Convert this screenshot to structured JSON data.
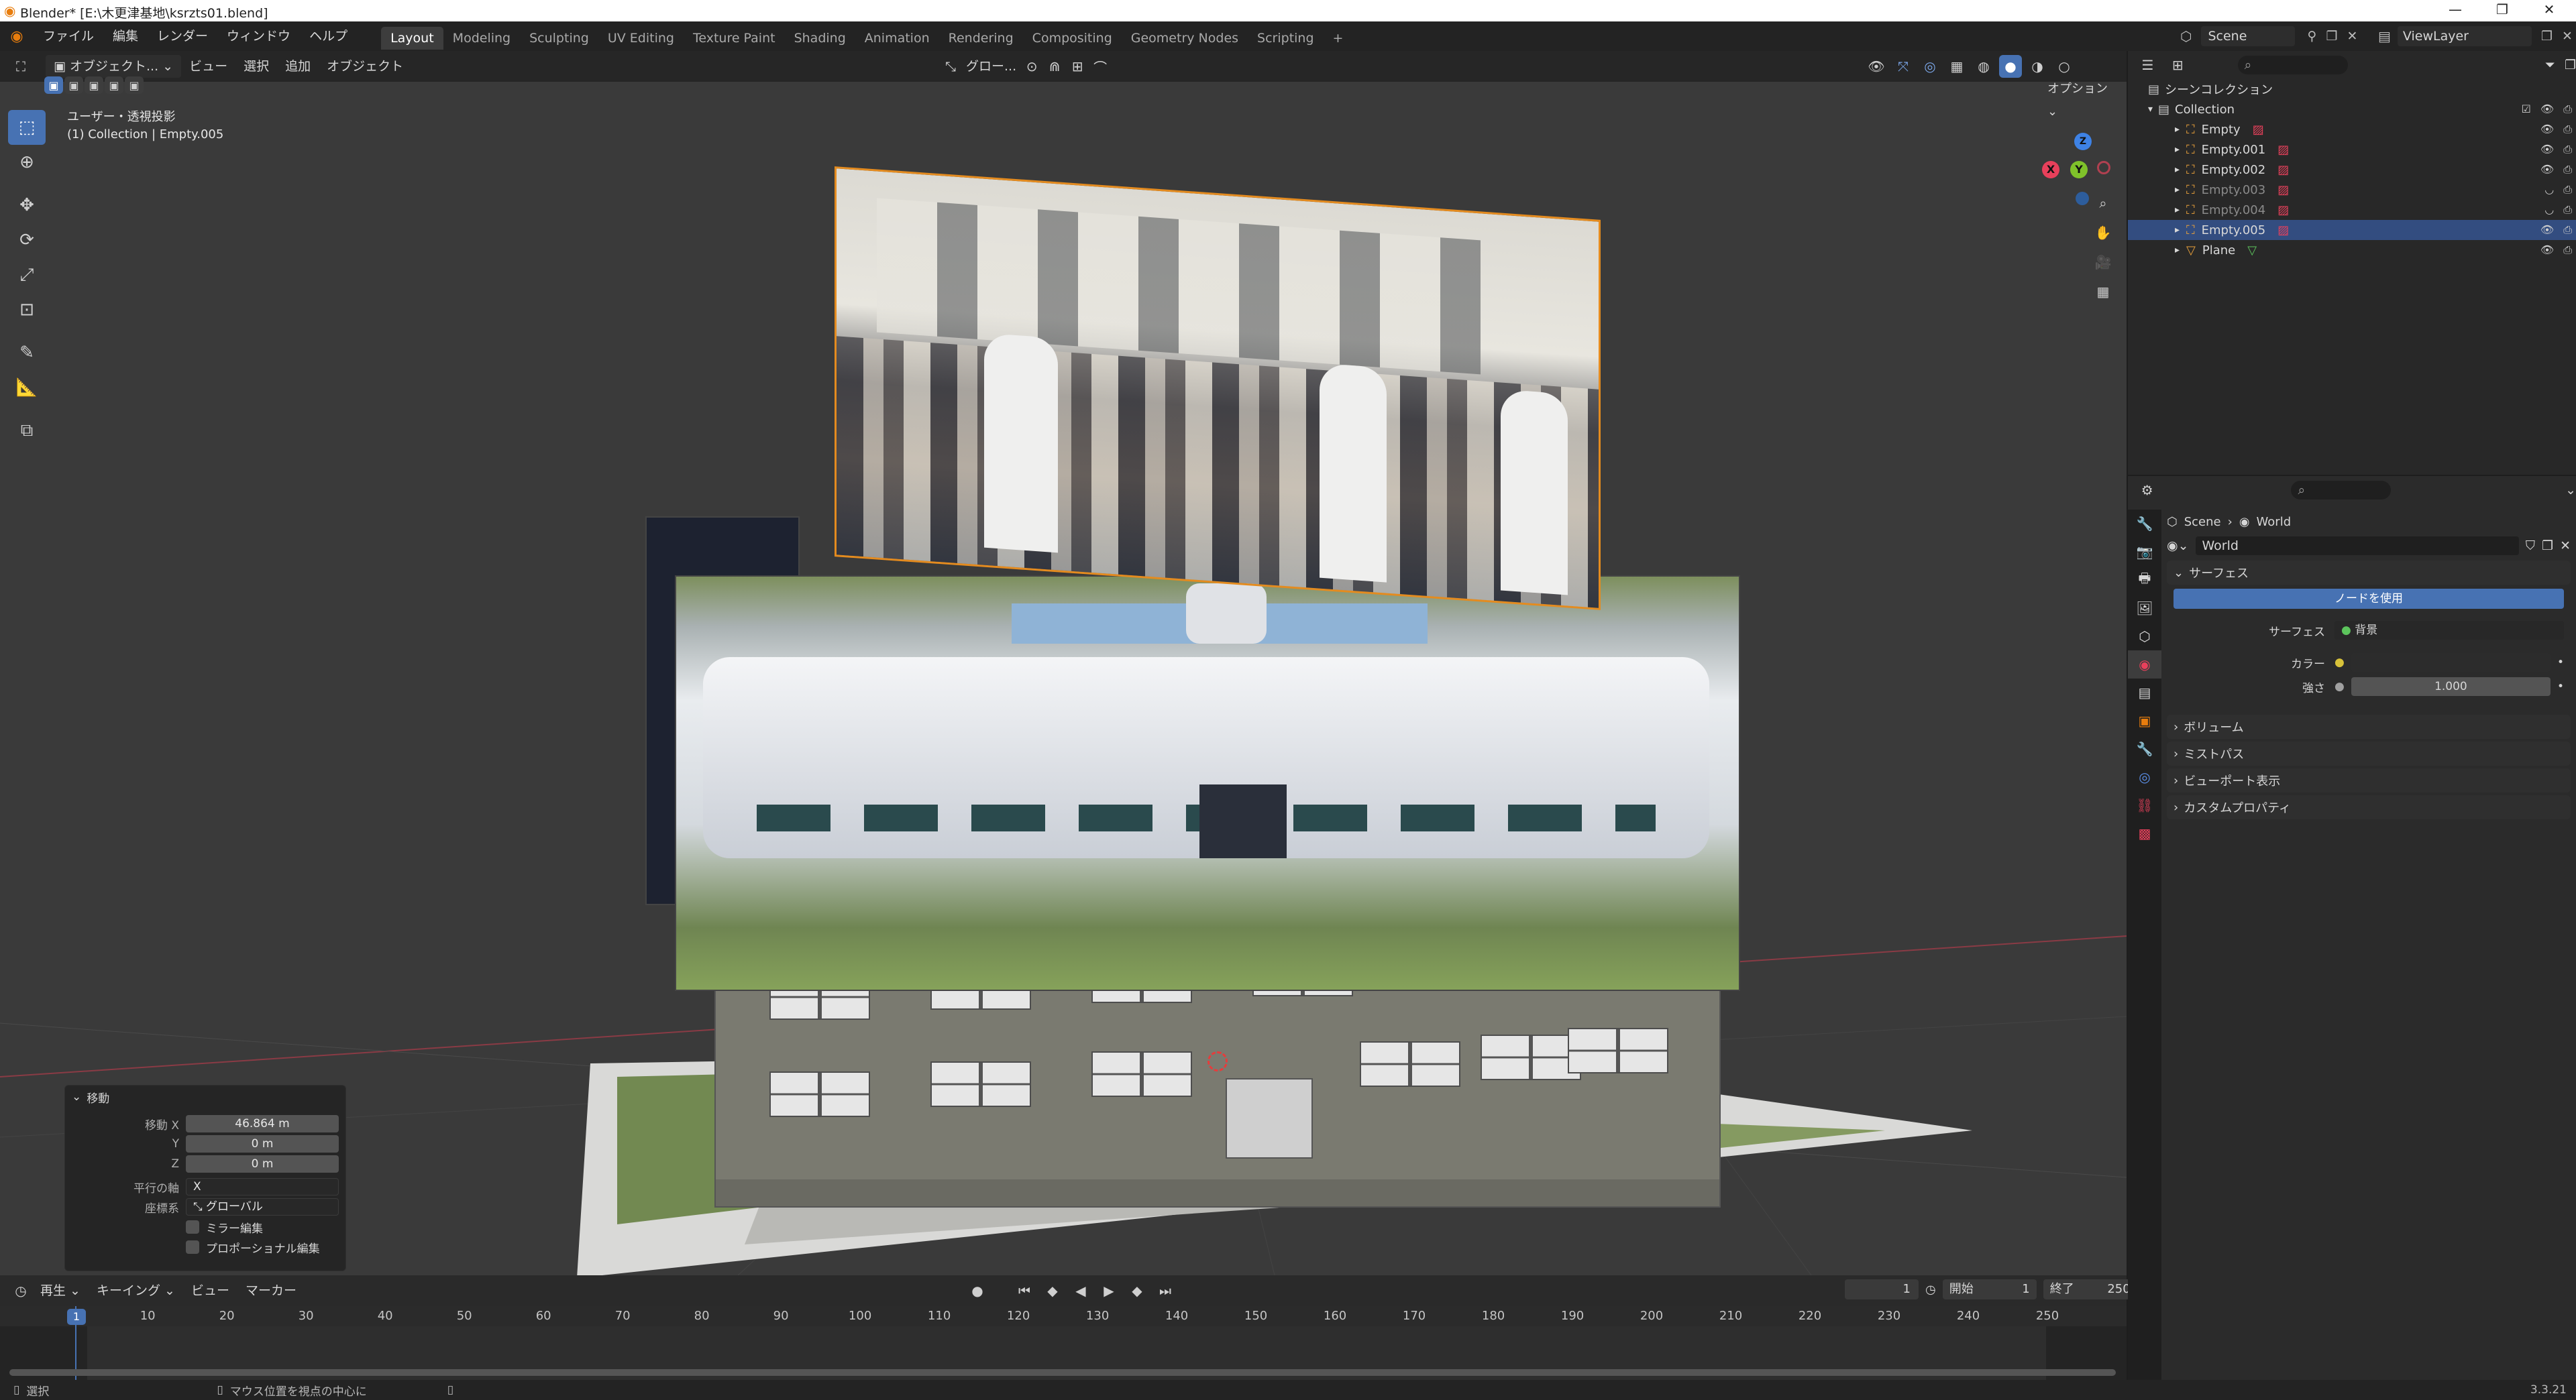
{
  "window": {
    "title": "Blender* [E:\\木更津基地\\ksrzts01.blend]",
    "controls": [
      "—",
      "❐",
      "✕"
    ]
  },
  "menubar": {
    "items": [
      "ファイル",
      "編集",
      "レンダー",
      "ウィンドウ",
      "ヘルプ"
    ],
    "workspaces": [
      "Layout",
      "Modeling",
      "Sculpting",
      "UV Editing",
      "Texture Paint",
      "Shading",
      "Animation",
      "Rendering",
      "Compositing",
      "Geometry Nodes",
      "Scripting"
    ],
    "add_tab": "+",
    "scene_name": "Scene",
    "view_layer": "ViewLayer"
  },
  "viewport": {
    "mode": "オブジェクト...",
    "menu": [
      "ビュー",
      "選択",
      "追加",
      "オブジェクト"
    ],
    "transform_orientation": "グロー...",
    "options": "オプション",
    "view_name": "ユーザー・透視投影",
    "collection_info": "(1) Collection | Empty.005",
    "gizmo": {
      "x": "X",
      "y": "Y",
      "z": "Z"
    }
  },
  "operator_panel": {
    "title": "移動",
    "move_x_label": "移動 X",
    "move_x": "46.864 m",
    "y_label": "Y",
    "y": "0 m",
    "z_label": "Z",
    "z": "0 m",
    "axis_label": "平行の軸",
    "axis": "X",
    "orient_label": "座標系",
    "orient": "グローバル",
    "mirror": "ミラー編集",
    "proportional": "プロポーショナル編集"
  },
  "timeline": {
    "menu": [
      "再生",
      "キーイング",
      "ビュー",
      "マーカー"
    ],
    "current_frame": "1",
    "start_label": "開始",
    "start": "1",
    "end_label": "終了",
    "end": "250",
    "frames": [
      "1",
      "10",
      "20",
      "30",
      "40",
      "50",
      "60",
      "70",
      "80",
      "90",
      "100",
      "110",
      "120",
      "130",
      "140",
      "150",
      "160",
      "170",
      "180",
      "190",
      "200",
      "210",
      "220",
      "230",
      "240",
      "250"
    ]
  },
  "statusbar": {
    "select": "選択",
    "center_view": "マウス位置を視点の中心に",
    "version": "3.3.21"
  },
  "outliner": {
    "scene_collection": "シーンコレクション",
    "collection": "Collection",
    "items": [
      {
        "name": "Empty",
        "selected": false,
        "hidden": false
      },
      {
        "name": "Empty.001",
        "selected": false,
        "hidden": false
      },
      {
        "name": "Empty.002",
        "selected": false,
        "hidden": false
      },
      {
        "name": "Empty.003",
        "selected": false,
        "hidden": true
      },
      {
        "name": "Empty.004",
        "selected": false,
        "hidden": true
      },
      {
        "name": "Empty.005",
        "selected": true,
        "hidden": false
      },
      {
        "name": "Plane",
        "selected": false,
        "hidden": false
      }
    ]
  },
  "properties": {
    "breadcrumb_scene": "Scene",
    "breadcrumb_world": "World",
    "world_name": "World",
    "surface_panel": "サーフェス",
    "use_nodes": "ノードを使用",
    "surface_label": "サーフェス",
    "surface_value": "背景",
    "color_label": "カラー",
    "strength_label": "強さ",
    "strength_value": "1.000",
    "panels": [
      "ボリューム",
      "ミストパス",
      "ビューポート表示",
      "カスタムプロパティ"
    ]
  },
  "colors": {
    "accent": "#4772b3",
    "selection": "#e48b1f",
    "axis_x": "#e8405b",
    "axis_y": "#7fc22a",
    "axis_z": "#3e82e5"
  }
}
